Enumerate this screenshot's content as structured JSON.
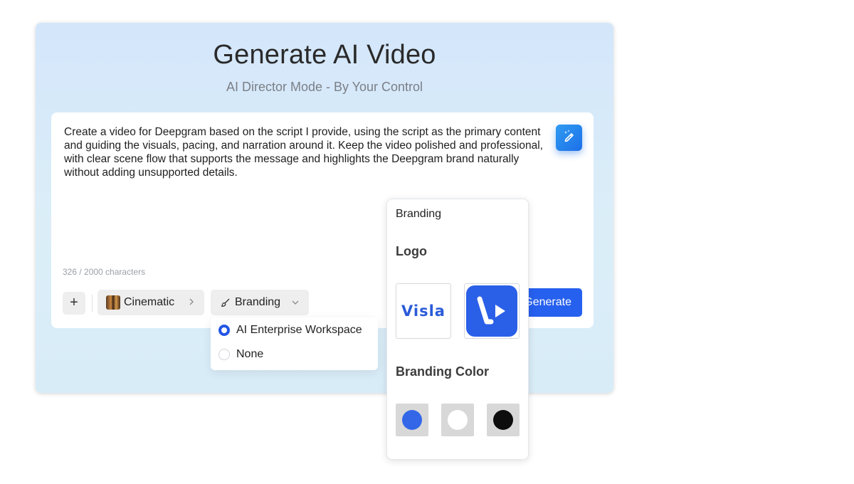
{
  "header": {
    "title": "Generate AI Video",
    "subtitle": "AI Director Mode - By Your Control"
  },
  "prompt": {
    "text": "Create a video for Deepgram based on the script I provide, using the script as the primary content and guiding the visuals, pacing, and narration around it. Keep the video polished and professional, with clear scene flow that supports the message and highlights the Deepgram brand naturally without adding unsupported details.",
    "char_count": "326 / 2000 characters",
    "magic_icon": "magic-wand-icon"
  },
  "toolbar": {
    "plus_label": "+",
    "style_label": "Cinematic",
    "branding_label": "Branding",
    "generate_label": "Generate"
  },
  "branding_dropdown": {
    "options": [
      {
        "label": "AI Enterprise Workspace",
        "selected": true
      },
      {
        "label": "None",
        "selected": false
      }
    ]
  },
  "branding_panel": {
    "title": "Branding",
    "logo_heading": "Logo",
    "logos": [
      "Visla",
      "V"
    ],
    "color_heading": "Branding Color",
    "colors": [
      "#3367e8",
      "#ffffff",
      "#0d0d0d"
    ]
  },
  "colors": {
    "accent": "#2660ee",
    "selected_radio": "#2456e6"
  }
}
